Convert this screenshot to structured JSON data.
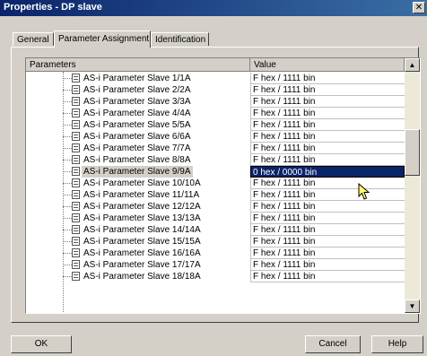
{
  "window": {
    "title": "Properties - DP slave",
    "close_glyph": "✕"
  },
  "tabs": [
    {
      "label": "General"
    },
    {
      "label": "Parameter Assignment"
    },
    {
      "label": "Identification"
    }
  ],
  "grid": {
    "columns": {
      "parameters": "Parameters",
      "value": "Value"
    },
    "rows": [
      {
        "name": "AS-i Parameter Slave 1/1A",
        "value": "F hex / 1111 bin"
      },
      {
        "name": "AS-i Parameter Slave 2/2A",
        "value": "F hex / 1111 bin"
      },
      {
        "name": "AS-i Parameter Slave 3/3A",
        "value": "F hex / 1111 bin"
      },
      {
        "name": "AS-i Parameter Slave 4/4A",
        "value": "F hex / 1111 bin"
      },
      {
        "name": "AS-i Parameter Slave 5/5A",
        "value": "F hex / 1111 bin"
      },
      {
        "name": "AS-i Parameter Slave 6/6A",
        "value": "F hex / 1111 bin"
      },
      {
        "name": "AS-i Parameter Slave 7/7A",
        "value": "F hex / 1111 bin"
      },
      {
        "name": "AS-i Parameter Slave 8/8A",
        "value": "F hex / 1111 bin"
      },
      {
        "name": "AS-i Parameter Slave 9/9A",
        "value": "0 hex / 0000 bin"
      },
      {
        "name": "AS-i Parameter Slave 10/10A",
        "value": "F hex / 1111 bin"
      },
      {
        "name": "AS-i Parameter Slave 11/11A",
        "value": "F hex / 1111 bin"
      },
      {
        "name": "AS-i Parameter Slave 12/12A",
        "value": "F hex / 1111 bin"
      },
      {
        "name": "AS-i Parameter Slave 13/13A",
        "value": "F hex / 1111 bin"
      },
      {
        "name": "AS-i Parameter Slave 14/14A",
        "value": "F hex / 1111 bin"
      },
      {
        "name": "AS-i Parameter Slave 15/15A",
        "value": "F hex / 1111 bin"
      },
      {
        "name": "AS-i Parameter Slave 16/16A",
        "value": "F hex / 1111 bin"
      },
      {
        "name": "AS-i Parameter Slave 17/17A",
        "value": "F hex / 1111 bin"
      },
      {
        "name": "AS-i Parameter Slave 18/18A",
        "value": "F hex / 1111 bin"
      }
    ],
    "scroll_up_glyph": "▲",
    "scroll_down_glyph": "▼"
  },
  "buttons": {
    "ok": "OK",
    "cancel": "Cancel",
    "help": "Help"
  },
  "colors": {
    "title_bar": "#0a246a",
    "selection": "#0a246a",
    "face": "#d4d0c8"
  },
  "icons": [
    "close-icon",
    "parameter-item-icon",
    "scroll-up-icon",
    "scroll-down-icon",
    "mouse-pointer-icon"
  ]
}
